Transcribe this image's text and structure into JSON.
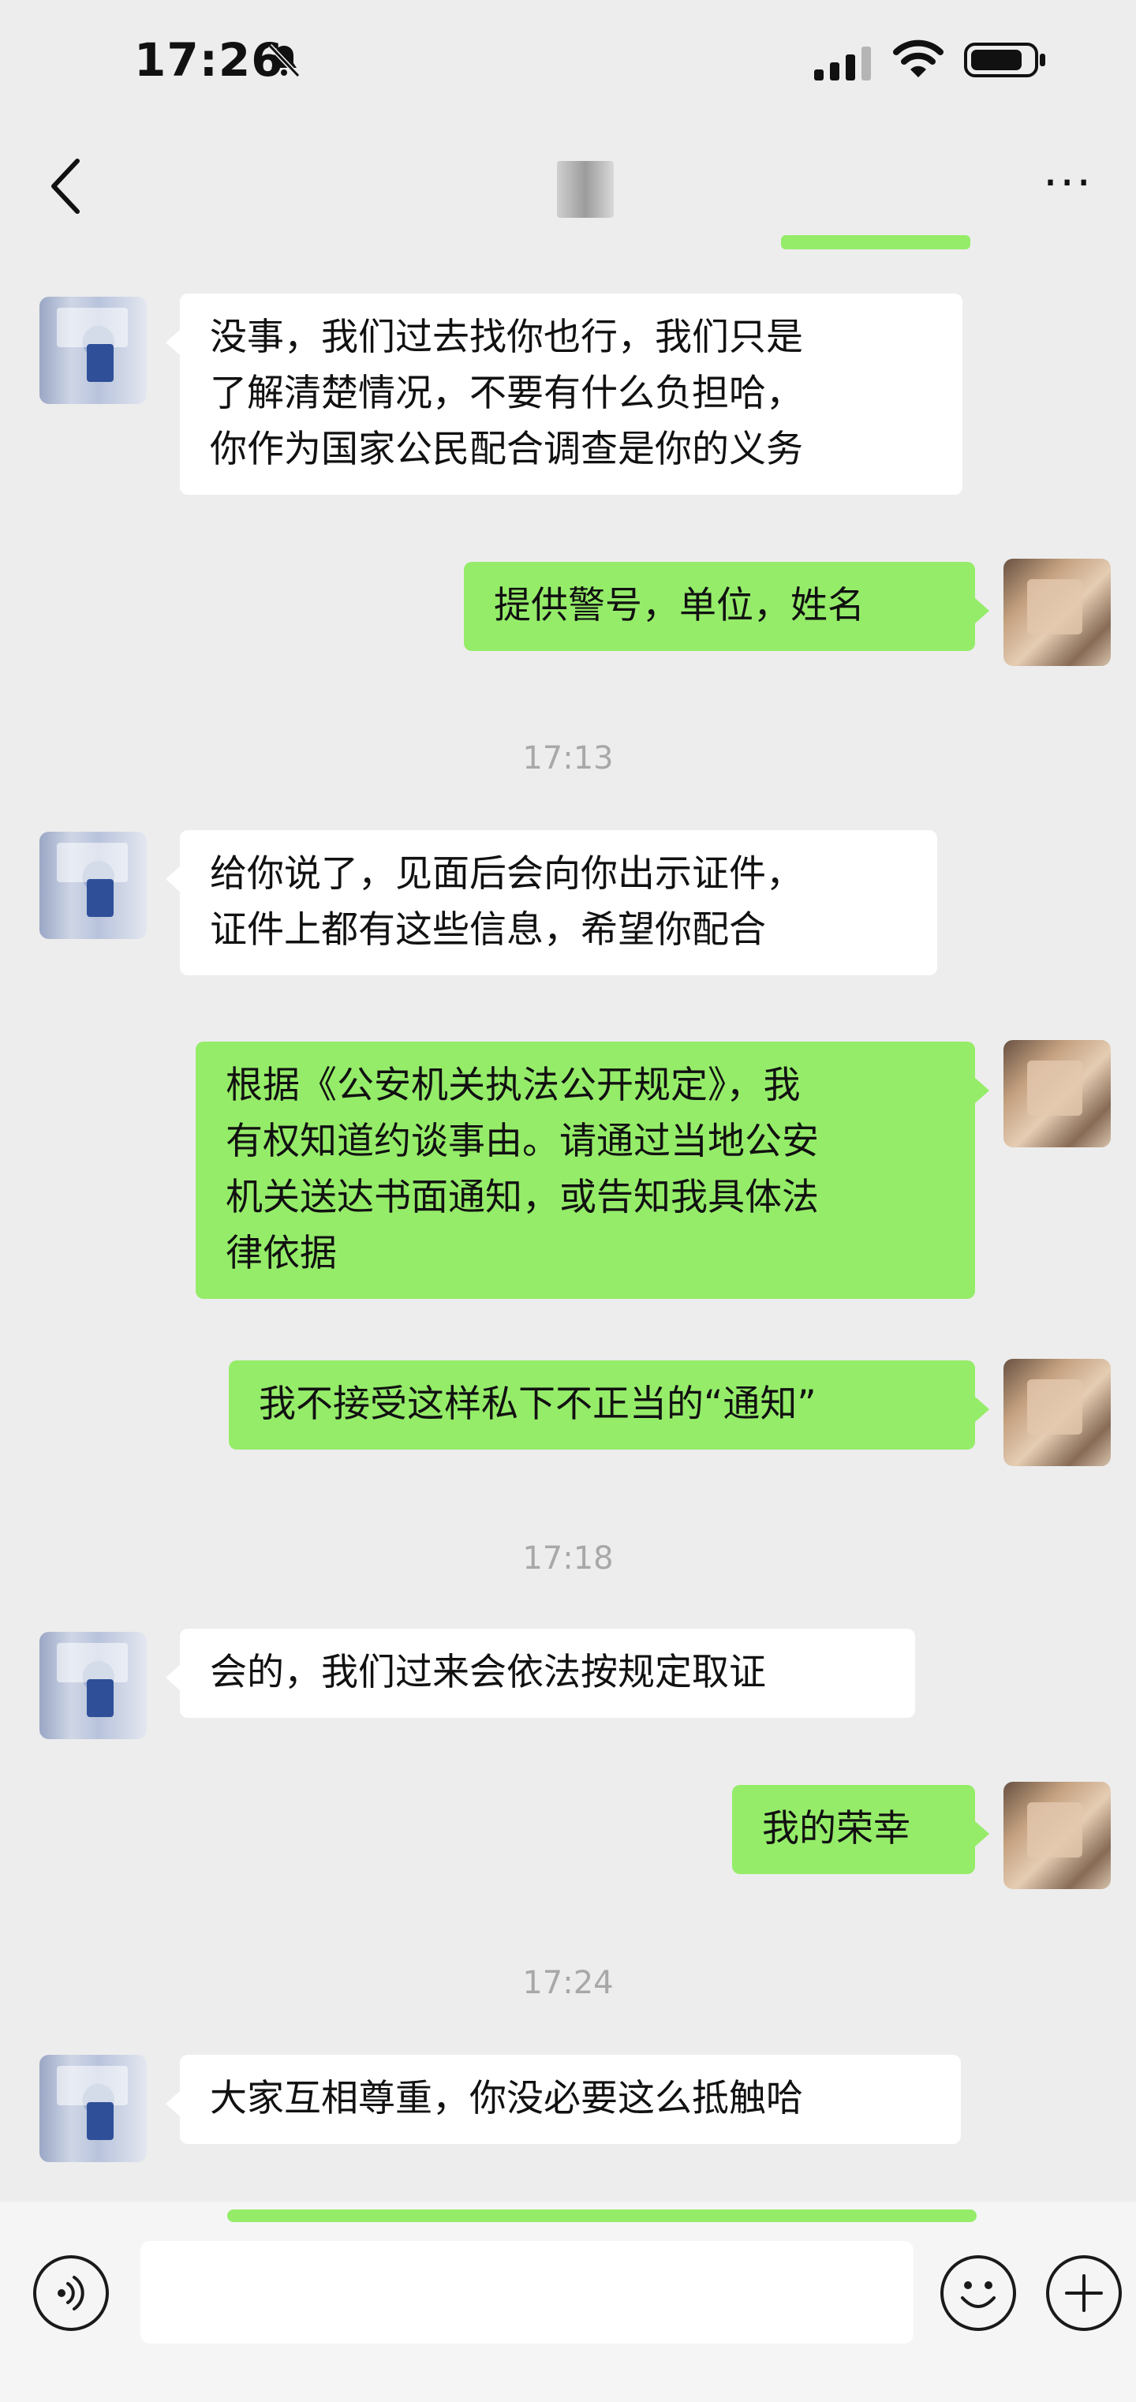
{
  "status_bar": {
    "time": "17:26",
    "icons": [
      "bell-muted-icon",
      "signal-icon",
      "wifi-icon",
      "battery-icon"
    ]
  },
  "nav": {
    "icons": [
      "back-icon",
      "contact-avatar",
      "more-icon"
    ]
  },
  "messages": [
    {
      "side": "in",
      "lines": [
        "没事，我们过去找你也行，我们只是",
        "了解清楚情况，不要有什么负担哈，",
        "你作为国家公民配合调查是你的义务"
      ]
    },
    {
      "side": "out",
      "lines": [
        "提供警号，单位，姓名"
      ]
    },
    {
      "timestamp": "17:13"
    },
    {
      "side": "in",
      "lines": [
        "给你说了，见面后会向你出示证件，",
        "证件上都有这些信息，希望你配合"
      ]
    },
    {
      "side": "out",
      "lines": [
        "根据《公安机关执法公开规定》，我",
        "有权知道约谈事由。请通过当地公安",
        "机关送达书面通知，或告知我具体法",
        "律依据"
      ]
    },
    {
      "side": "out",
      "lines": [
        "我不接受这样私下不正当的“通知”"
      ]
    },
    {
      "timestamp": "17:18"
    },
    {
      "side": "in",
      "lines": [
        "会的，我们过来会依法按规定取证"
      ]
    },
    {
      "side": "out",
      "lines": [
        "我的荣幸"
      ]
    },
    {
      "timestamp": "17:24"
    },
    {
      "side": "in",
      "lines": [
        "大家互相尊重，你没必要这么抵触哈"
      ]
    }
  ],
  "input_bar": {
    "icons": [
      "voice-icon",
      "emoji-icon",
      "plus-icon"
    ],
    "placeholder": ""
  },
  "colors": {
    "background": "#ededed",
    "incoming_bubble": "#ffffff",
    "outgoing_bubble": "#95ec69",
    "timestamp": "#a8a8a8"
  }
}
